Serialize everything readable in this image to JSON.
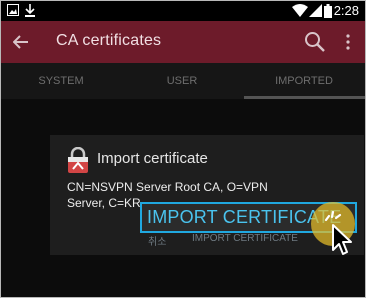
{
  "status_bar": {
    "time": "2:28",
    "icons": [
      "image-icon",
      "download-icon",
      "wifi-icon",
      "signal-icon",
      "battery-icon"
    ]
  },
  "action_bar": {
    "title": "CA certificates",
    "icons": [
      "back-arrow-icon",
      "search-icon",
      "more-vert-icon"
    ]
  },
  "tabs": [
    {
      "label": "SYSTEM",
      "selected": false
    },
    {
      "label": "USER",
      "selected": false
    },
    {
      "label": "IMPORTED",
      "selected": true
    }
  ],
  "dialog": {
    "icon": "certificate-lock-icon",
    "title": "Import certificate",
    "message": "CN=NSVPN Server Root CA, O=VPN Server, C=KR",
    "cancel_label": "취소",
    "import_label": "IMPORT CERTIFICATE"
  },
  "zoom_callout": {
    "label": "IMPORT CERTIFICATE"
  },
  "colors": {
    "action_bar": "#6d1b2a",
    "highlight": "#20a8e0",
    "tap": "#e8be28"
  }
}
